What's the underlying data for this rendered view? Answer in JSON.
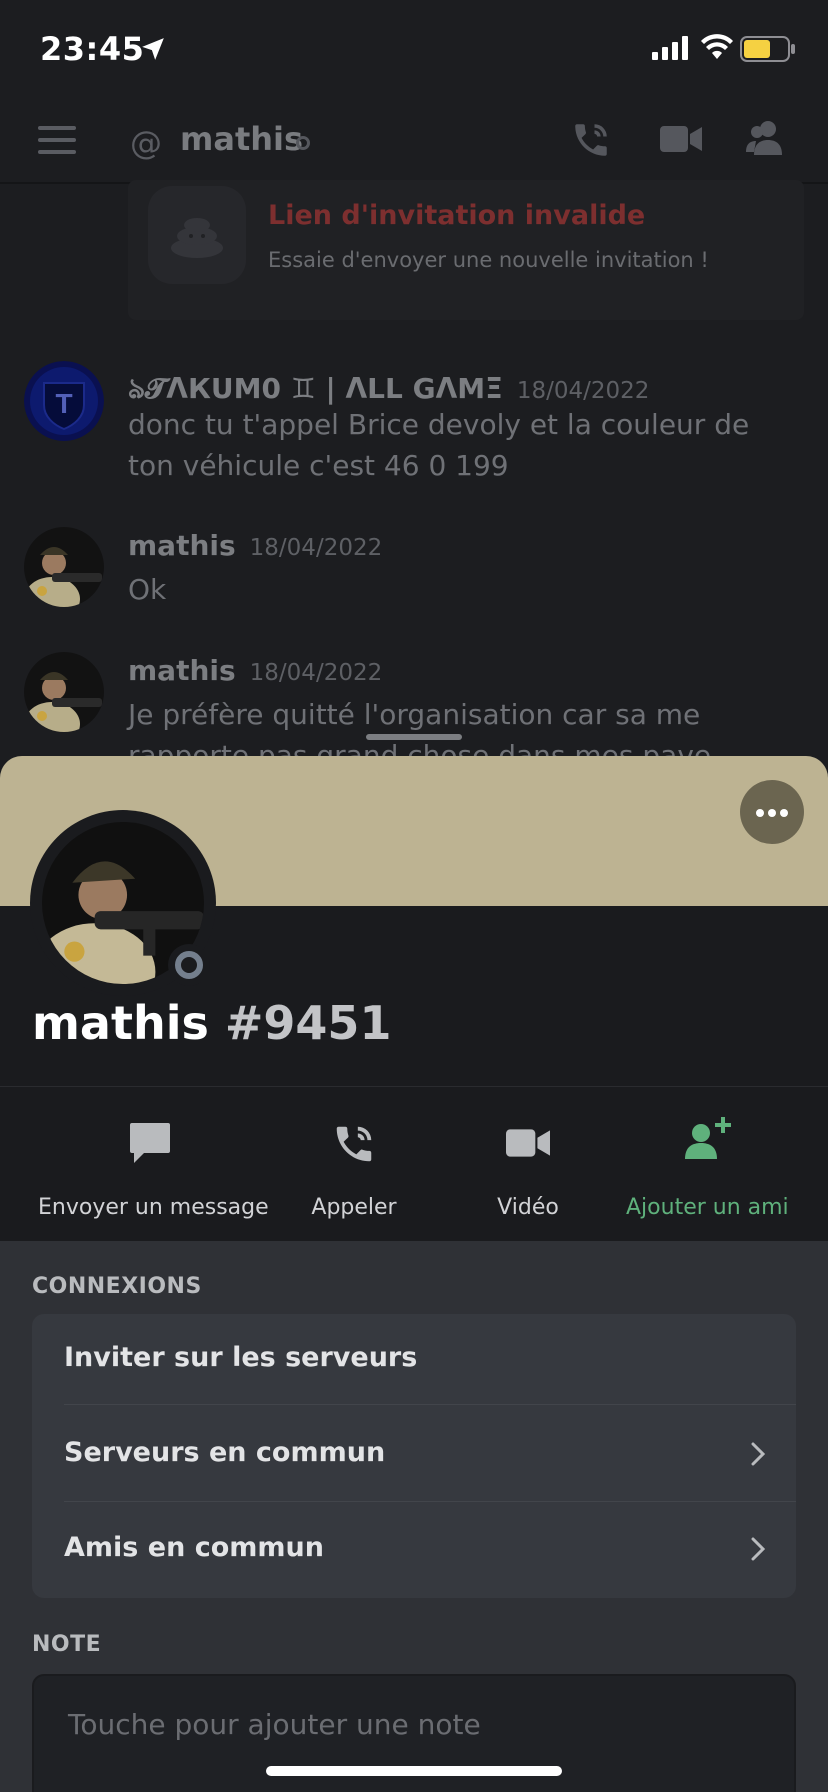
{
  "status_bar": {
    "time": "23:45"
  },
  "header": {
    "channel_name": "mathis"
  },
  "invite": {
    "title": "Lien d'invitation invalide",
    "subtitle": "Essaie d'envoyer une nouvelle invitation !"
  },
  "messages": [
    {
      "author": "ঌ𝓣ΛКUM0 ♊ | ΛLL GΛMΞ",
      "date": "18/04/2022",
      "text": "donc tu t'appel  Brice devoly et la couleur de ton véhicule c'est 46 0 199"
    },
    {
      "author": "mathis",
      "date": "18/04/2022",
      "text": "Ok"
    },
    {
      "author": "mathis",
      "date": "18/04/2022",
      "text": "Je préfère quitté l'organisation car sa me rapporte pas grand chose dans mes pave"
    }
  ],
  "profile": {
    "name": "mathis",
    "discriminator": "#9451",
    "banner_color": "#bdb392",
    "actions": [
      {
        "label": "Envoyer un message",
        "icon": "message-icon"
      },
      {
        "label": "Appeler",
        "icon": "phone-call-icon"
      },
      {
        "label": "Vidéo",
        "icon": "video-icon"
      },
      {
        "label": "Ajouter un ami",
        "icon": "add-friend-icon"
      }
    ],
    "connections_title": "CONNEXIONS",
    "connections": [
      {
        "label": "Inviter sur les serveurs"
      },
      {
        "label": "Serveurs en commun"
      },
      {
        "label": "Amis en commun"
      }
    ],
    "note_title": "NOTE",
    "note_placeholder": "Touche pour ajouter une note"
  },
  "colors": {
    "add_friend_green": "#5fb17c",
    "offline_gray": "#747f8d"
  }
}
